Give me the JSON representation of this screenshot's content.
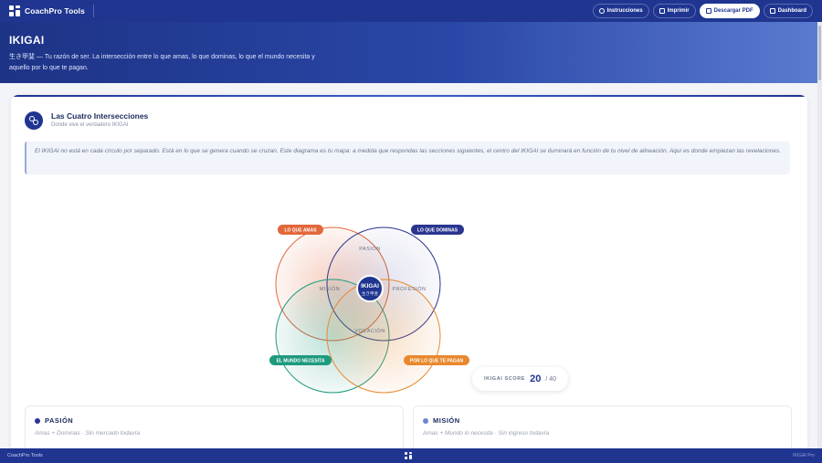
{
  "app": {
    "brand": "CoachPro Tools"
  },
  "nav": [
    {
      "label": "Instrucciones",
      "icon": "lightbulb-icon"
    },
    {
      "label": "Imprimir",
      "icon": "print-icon"
    },
    {
      "label": "Descargar PDF",
      "icon": "download-icon"
    },
    {
      "label": "Dashboard",
      "icon": "grid-icon"
    }
  ],
  "hero": {
    "title": "IKIGAI",
    "subtitle": "生き甲斐 — Tu razón de ser. La intersección entre lo que amas, lo que dominas, lo que el mundo necesita y aquello por lo que te pagan."
  },
  "section": {
    "title": "Las Cuatro Intersecciones",
    "subtitle": "Donde vive el verdadero IKIGAI",
    "intro": "El IKIGAI no está en cada círculo por separado. Está en lo que se genera cuando se cruzan. Este diagrama es tu mapa: a medida que respondas las secciones siguientes, el centro del IKIGAI se iluminará en función de tu nivel de alineación. Aquí es donde empiezan las revelaciones."
  },
  "venn": {
    "labels": {
      "love": "LO QUE AMAS",
      "good_at": "LO QUE DOMINAS",
      "world_needs": "EL MUNDO NECESITA",
      "paid_for": "POR LO QUE TE PAGAN"
    },
    "intersections": {
      "passion": "PASIÓN",
      "mission": "MISIÓN",
      "profession": "PROFESIÓN",
      "vocation": "VOCACIÓN"
    },
    "center_title": "IKIGAI",
    "center_sub": "生き甲斐",
    "colors": {
      "love": "#e2673a",
      "good_at": "#2a3590",
      "world_needs": "#1f9a7f",
      "paid_for": "#e8892e"
    }
  },
  "score": {
    "label": "IKIGAI SCORE",
    "value": "20",
    "max": "/ 40"
  },
  "cards": [
    {
      "title": "PASIÓN",
      "desc": "Amas + Dominas · Sin mercado todavía",
      "dot_color": "#2a3590"
    },
    {
      "title": "MISIÓN",
      "desc": "Amas + Mundo lo necesita · Sin ingreso todavía",
      "dot_color": "#6f86cf"
    }
  ],
  "footer": {
    "left": "CoachPro Tools",
    "right": "IKIGAI Pro"
  }
}
